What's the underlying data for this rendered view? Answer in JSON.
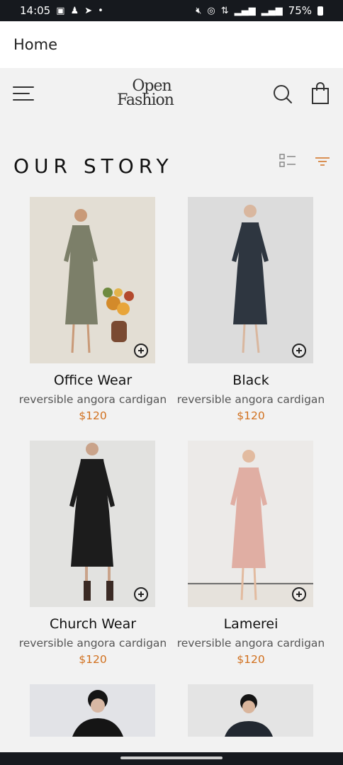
{
  "status_bar": {
    "time": "14:05",
    "battery": "75%"
  },
  "app_bar": {
    "title": "Home"
  },
  "header": {
    "logo_line1": "Open",
    "logo_line2": "Fashion"
  },
  "section": {
    "title": "OUR STORY"
  },
  "products": [
    {
      "name": "Office Wear",
      "desc": "reversible angora cardigan",
      "price": "$120"
    },
    {
      "name": "Black",
      "desc": "reversible angora cardigan",
      "price": "$120"
    },
    {
      "name": "Church Wear",
      "desc": "reversible angora cardigan",
      "price": "$120"
    },
    {
      "name": "Lamerei",
      "desc": "reversible angora cardigan",
      "price": "$120"
    }
  ],
  "colors": {
    "accent": "#d1701e",
    "statusbar": "#16191e"
  }
}
